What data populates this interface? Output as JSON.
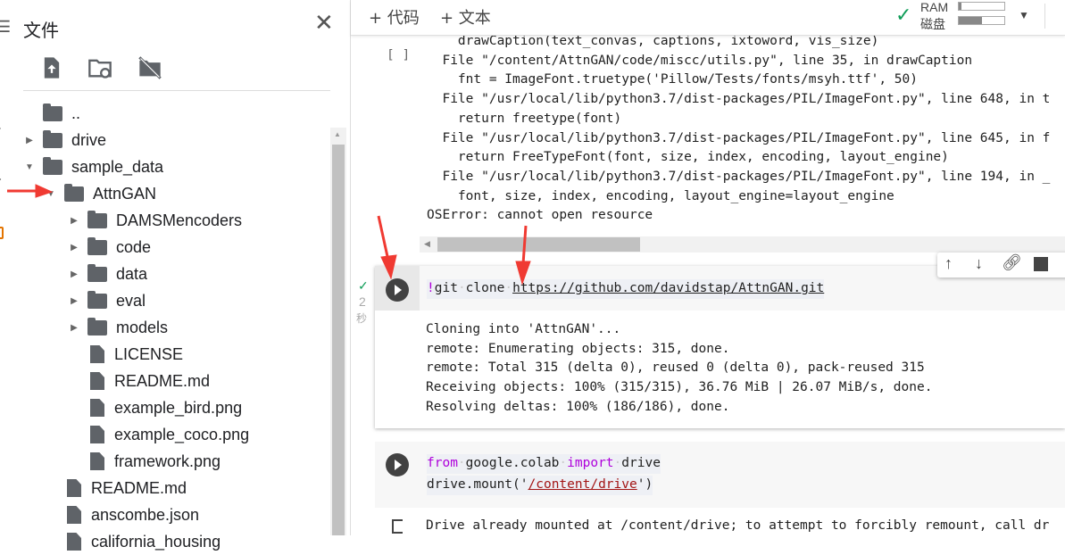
{
  "sidebar": {
    "title": "文件",
    "close": "✕",
    "tree": [
      {
        "label": "..",
        "type": "up",
        "level": 0
      },
      {
        "label": "drive",
        "type": "folder",
        "level": 0,
        "state": "collapsed"
      },
      {
        "label": "sample_data",
        "type": "folder",
        "level": 0,
        "state": "expanded"
      },
      {
        "label": "AttnGAN",
        "type": "folder",
        "level": 1,
        "state": "expanded"
      },
      {
        "label": "DAMSMencoders",
        "type": "folder",
        "level": 2,
        "state": "collapsed"
      },
      {
        "label": "code",
        "type": "folder",
        "level": 2,
        "state": "collapsed"
      },
      {
        "label": "data",
        "type": "folder",
        "level": 2,
        "state": "collapsed"
      },
      {
        "label": "eval",
        "type": "folder",
        "level": 2,
        "state": "collapsed"
      },
      {
        "label": "models",
        "type": "folder",
        "level": 2,
        "state": "collapsed"
      },
      {
        "label": "LICENSE",
        "type": "file",
        "level": 2
      },
      {
        "label": "README.md",
        "type": "file",
        "level": 2
      },
      {
        "label": "example_bird.png",
        "type": "file",
        "level": 2
      },
      {
        "label": "example_coco.png",
        "type": "file",
        "level": 2
      },
      {
        "label": "framework.png",
        "type": "file",
        "level": 2
      },
      {
        "label": "README.md",
        "type": "file",
        "level": 1
      },
      {
        "label": "anscombe.json",
        "type": "file",
        "level": 1
      },
      {
        "label": "california_housing",
        "type": "file",
        "level": 1
      }
    ]
  },
  "toolbar": {
    "add_code": "+ 代码",
    "add_text": "+ 文本",
    "ram": "RAM",
    "disk": "磁盘",
    "ram_usage": 0.05,
    "disk_usage": 0.5
  },
  "cell1": {
    "bracket": "[ ]",
    "output": [
      "    drawCaption(text_convas, captions, ixtoword, vis_size)",
      "  File \"/content/AttnGAN/code/miscc/utils.py\", line 35, in drawCaption",
      "    fnt = ImageFont.truetype('Pillow/Tests/fonts/msyh.ttf', 50)",
      "  File \"/usr/local/lib/python3.7/dist-packages/PIL/ImageFont.py\", line 648, in t",
      "    return freetype(font)",
      "  File \"/usr/local/lib/python3.7/dist-packages/PIL/ImageFont.py\", line 645, in f",
      "    return FreeTypeFont(font, size, index, encoding, layout_engine)",
      "  File \"/usr/local/lib/python3.7/dist-packages/PIL/ImageFont.py\", line 194, in _",
      "    font, size, index, encoding, layout_engine=layout_engine",
      "OSError: cannot open resource"
    ]
  },
  "cell2": {
    "status": "✓",
    "time": "2",
    "time_unit": "秒",
    "code_bang": "!",
    "code_cmd": "git",
    "code_arg": "clone",
    "code_url": "https://github.com/davidstap/AttnGAN.git",
    "output": [
      "Cloning into 'AttnGAN'...",
      "remote: Enumerating objects: 315, done.",
      "remote: Total 315 (delta 0), reused 0 (delta 0), pack-reused 315",
      "Receiving objects: 100% (315/315), 36.76 MiB | 26.07 MiB/s, done.",
      "Resolving deltas: 100% (186/186), done."
    ]
  },
  "cell3": {
    "kw_from": "from",
    "mod": "google.colab",
    "kw_import": "import",
    "name": "drive",
    "line2_pre": "drive.mount('",
    "line2_str": "/content/drive",
    "line2_post": "')",
    "output": "Drive already mounted at /content/drive; to attempt to forcibly remount, call dr"
  },
  "colors": {
    "accent": "#1a73e8",
    "annotation": "#f03a32",
    "keyword": "#af00db",
    "string": "#a31515"
  }
}
